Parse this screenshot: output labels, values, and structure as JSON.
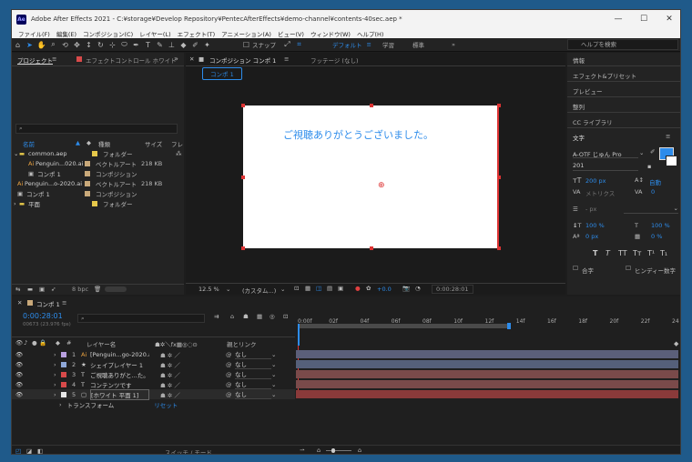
{
  "window": {
    "title": "Adobe After Effects 2021 - C:¥storage¥Develop Repository¥PentecAfterEffects¥demo-channel¥contents-40sec.aep *",
    "logo": "Ae",
    "controls": [
      "minimize-icon",
      "maximize-icon",
      "close-icon"
    ]
  },
  "menu": [
    "ファイル(F)",
    "編集(E)",
    "コンポジション(C)",
    "レイヤー(L)",
    "エフェクト(T)",
    "アニメーション(A)",
    "ビュー(V)",
    "ウィンドウ(W)",
    "ヘルプ(H)"
  ],
  "toolbar": {
    "snap_label": "スナップ",
    "workspaces": [
      "デフォルト",
      "学習",
      "標準"
    ],
    "search_placeholder": "ヘルプを検索"
  },
  "project": {
    "tab": "プロジェクト",
    "effect_tab": "エフェクトコントロール ホワイト",
    "columns": {
      "name": "名前",
      "type": "種類",
      "size": "サイズ",
      "fl": "フレ"
    },
    "items": [
      {
        "name": "common.aep",
        "type": "フォルダー",
        "size": "",
        "color": "#e6c84a"
      },
      {
        "name": "Penguin...020.ai",
        "type": "ベクトルアート",
        "size": "218 KB",
        "color": "#c9a97a"
      },
      {
        "name": "コンポ 1",
        "type": "コンポジション",
        "size": "",
        "color": "#c9a97a"
      },
      {
        "name": "Penguin...o-2020.ai",
        "type": "ベクトルアート",
        "size": "218 KB",
        "color": "#c9a97a"
      },
      {
        "name": "コンポ 1",
        "type": "コンポジション",
        "size": "",
        "color": "#c9a97a"
      },
      {
        "name": "平面",
        "type": "フォルダー",
        "size": "",
        "color": "#e6c84a"
      }
    ],
    "bpc": "8 bpc"
  },
  "comp": {
    "tab": "コンポジション コンポ 1",
    "footage_tab": "フッテージ (なし)",
    "sub_tab": "コンポ 1",
    "text": "ご視聴ありがとうございました。",
    "zoom": "12.5 %",
    "resolution": "(カスタム...)",
    "exposure": "+0.0",
    "timecode": "0:00:28:01"
  },
  "right_panel": {
    "items": [
      "情報",
      "エフェクト&プリセット",
      "プレビュー",
      "整列",
      "CC ライブラリ"
    ],
    "char_title": "文字",
    "font": "A-OTF じゅん Pro",
    "font_style": "201",
    "size": "200 px",
    "leading": "自動",
    "tracking_label": "メトリクス",
    "tracking": "0",
    "stroke": "- px",
    "vscale": "100 %",
    "hscale": "100 %",
    "baseline": "0 px",
    "tsume": "0 %",
    "styles": [
      "T",
      "T",
      "TT",
      "Tт",
      "T¹",
      "T₁"
    ],
    "check1": "合字",
    "check2": "ヒンディー数字",
    "fill_color": "#2d8ceb"
  },
  "timeline": {
    "tab": "コンポ 1",
    "time": "0:00:28:01",
    "fps": "00673 (23.976 fps)",
    "headers": {
      "name": "レイヤー名",
      "parent": "親とリンク"
    },
    "layers": [
      {
        "num": "1",
        "name": "[Penguin...go-2020.ai]",
        "parent": "なし",
        "label": "#b9a0e0",
        "bar": "#5b5f7a",
        "kind": "img"
      },
      {
        "num": "2",
        "name": "シェイプレイヤー 1",
        "parent": "なし",
        "label": "#8fa8d8",
        "bar": "#55607a",
        "kind": "star"
      },
      {
        "num": "3",
        "name": "ご視聴ありがと...た。",
        "parent": "なし",
        "label": "#d84a4a",
        "bar": "#7a4a4a",
        "kind": "T"
      },
      {
        "num": "4",
        "name": "コンテンツです",
        "parent": "なし",
        "label": "#d84a4a",
        "bar": "#7a4a4a",
        "kind": "T"
      },
      {
        "num": "5",
        "name": "[ホワイト 平面 1]",
        "parent": "なし",
        "label": "#e8e8e8",
        "bar": "#8a3a3a",
        "kind": "solid"
      }
    ],
    "transform": "トランスフォーム",
    "reset": "リセット",
    "ruler": [
      "0:00f",
      "02f",
      "04f",
      "06f",
      "08f",
      "10f",
      "12f",
      "14f",
      "16f",
      "18f",
      "20f",
      "22f",
      "24"
    ],
    "switch_mode": "スイッチ / モード"
  }
}
